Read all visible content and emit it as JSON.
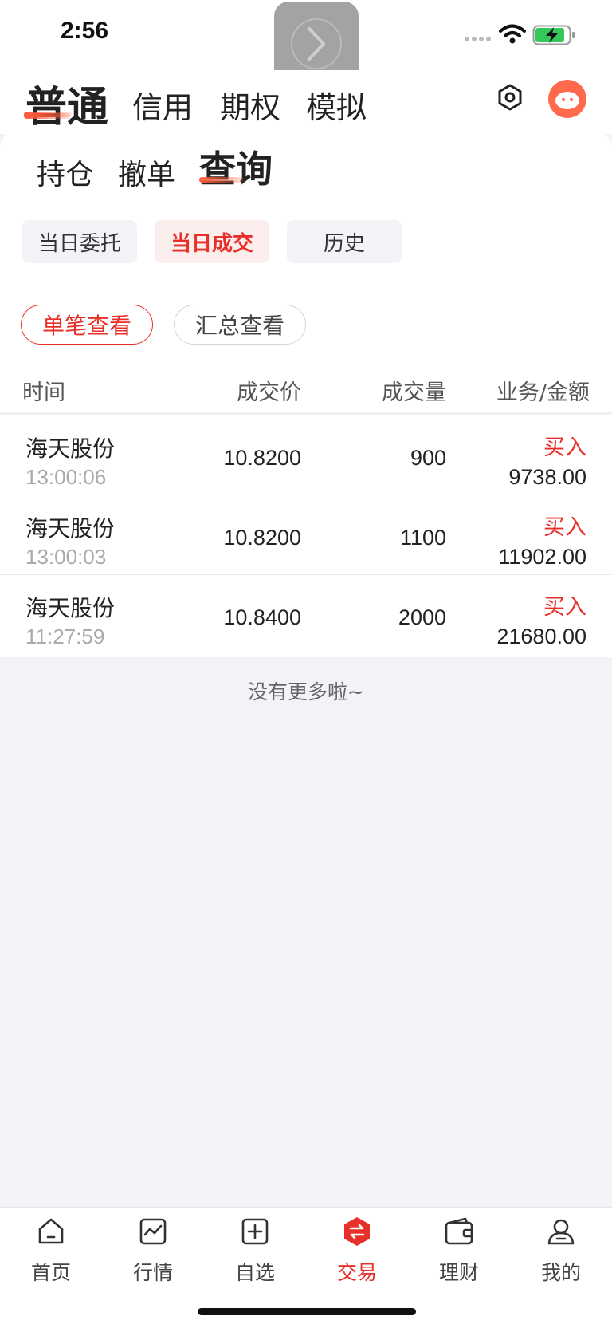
{
  "status": {
    "time": "2:56"
  },
  "header": {
    "tabs": [
      "普通",
      "信用",
      "期权",
      "模拟"
    ],
    "active_tab": "普通"
  },
  "subtabs": {
    "items": [
      "持仓",
      "撤单",
      "查询"
    ],
    "active": "查询"
  },
  "segments": {
    "items": [
      "当日委托",
      "当日成交",
      "历史"
    ],
    "active": "当日成交"
  },
  "view_mode": {
    "items": [
      "单笔查看",
      "汇总查看"
    ],
    "active": "单笔查看"
  },
  "table": {
    "columns": [
      "时间",
      "成交价",
      "成交量",
      "业务/金额"
    ],
    "rows": [
      {
        "name": "海天股份",
        "time": "13:00:06",
        "price": "10.8200",
        "qty": "900",
        "side": "买入",
        "amount": "9738.00"
      },
      {
        "name": "海天股份",
        "time": "13:00:03",
        "price": "10.8200",
        "qty": "1100",
        "side": "买入",
        "amount": "11902.00"
      },
      {
        "name": "海天股份",
        "time": "11:27:59",
        "price": "10.8400",
        "qty": "2000",
        "side": "买入",
        "amount": "21680.00"
      }
    ],
    "footer": "没有更多啦~"
  },
  "tabbar": {
    "items": [
      {
        "label": "首页",
        "icon": "home-icon"
      },
      {
        "label": "行情",
        "icon": "chart-icon"
      },
      {
        "label": "自选",
        "icon": "add-favorite-icon"
      },
      {
        "label": "交易",
        "icon": "trade-icon"
      },
      {
        "label": "理财",
        "icon": "wallet-icon"
      },
      {
        "label": "我的",
        "icon": "profile-icon"
      }
    ],
    "active": "交易"
  },
  "colors": {
    "accent": "#e8302a",
    "background": "#f2f3f7"
  }
}
